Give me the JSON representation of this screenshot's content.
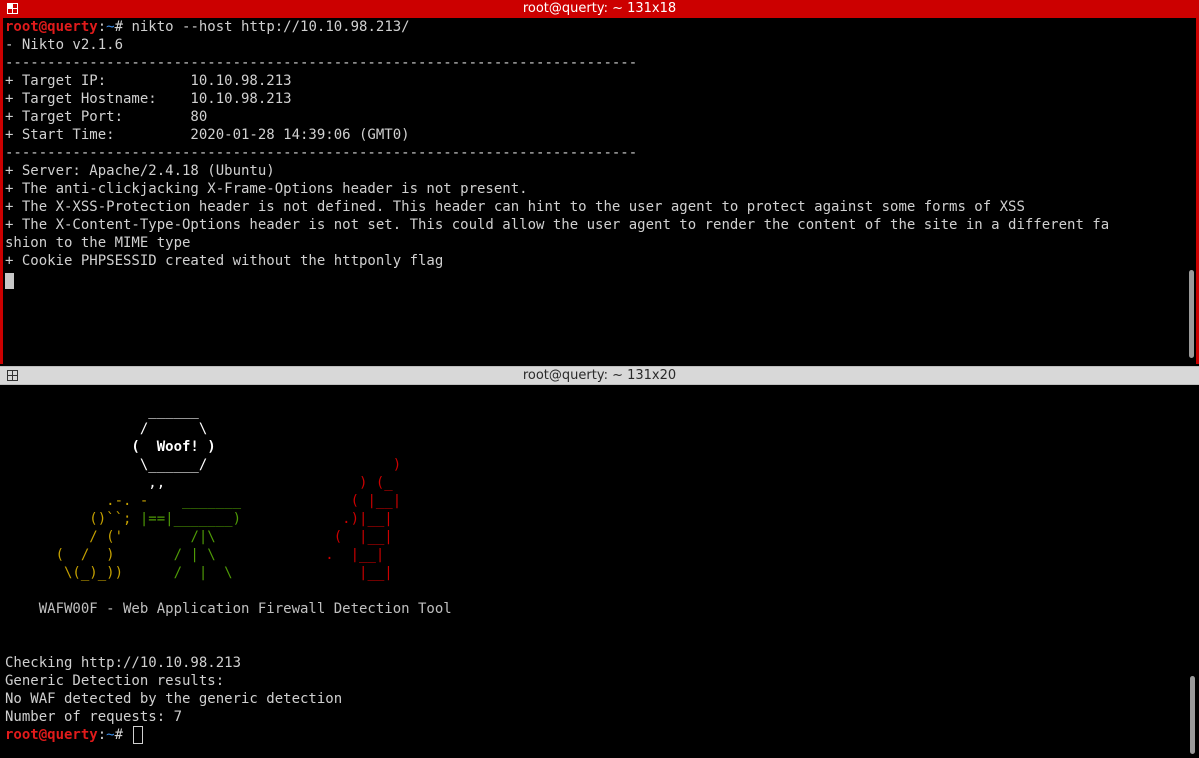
{
  "top_window": {
    "title": "root@querty: ~ 131x18",
    "prompt_user": "root@querty",
    "prompt_sep": ":",
    "prompt_path": "~",
    "prompt_hash": "# ",
    "command": "nikto --host http://10.10.98.213/",
    "output": [
      "- Nikto v2.1.6",
      "---------------------------------------------------------------------------",
      "+ Target IP:          10.10.98.213",
      "+ Target Hostname:    10.10.98.213",
      "+ Target Port:        80",
      "+ Start Time:         2020-01-28 14:39:06 (GMT0)",
      "---------------------------------------------------------------------------",
      "+ Server: Apache/2.4.18 (Ubuntu)",
      "+ The anti-clickjacking X-Frame-Options header is not present.",
      "+ The X-XSS-Protection header is not defined. This header can hint to the user agent to protect against some forms of XSS",
      "+ The X-Content-Type-Options header is not set. This could allow the user agent to render the content of the site in a different fa",
      "shion to the MIME type",
      "+ Cookie PHPSESSID created without the httponly flag"
    ]
  },
  "bottom_window": {
    "title": "root@querty: ~ 131x20",
    "ascii_art": [
      {
        "white": "                 ______",
        "red": ""
      },
      {
        "white": "                /      \\",
        "red": ""
      },
      {
        "white": "               (  Woof! )",
        "red": ""
      },
      {
        "white": "                \\______/",
        "red": "                      )"
      },
      {
        "white": "                 ,,",
        "red": "                       ) (_"
      },
      {
        "yellow": "            .-. -",
        "green": "    _______",
        "red": "             ( |__|"
      },
      {
        "yellow": "          ()``; ",
        "green": "|==|_______)",
        "red": "            .)|__|"
      },
      {
        "yellow": "          / ('",
        "green": "        /|\\",
        "red": "              (  |__|"
      },
      {
        "yellow": "      (  /  )",
        "green": "       / | \\",
        "red": "             .  |__|"
      },
      {
        "yellow": "       \\(_)_))",
        "green": "      /  |  \\",
        "red": "               |__|"
      }
    ],
    "tool_banner": "    WAFW00F - Web Application Firewall Detection Tool",
    "output": [
      "Checking http://10.10.98.213",
      "Generic Detection results:",
      "No WAF detected by the generic detection",
      "Number of requests: 7"
    ],
    "prompt_user": "root@querty",
    "prompt_sep": ":",
    "prompt_path": "~",
    "prompt_hash": "# "
  },
  "colors": {
    "active_titlebar": "#cc0000",
    "inactive_titlebar": "#d8d8d8",
    "prompt_user": "#e01b1b",
    "prompt_path": "#3b8eea",
    "art_yellow": "#c4a000",
    "art_green": "#4e9a06",
    "art_red": "#cc0000"
  }
}
